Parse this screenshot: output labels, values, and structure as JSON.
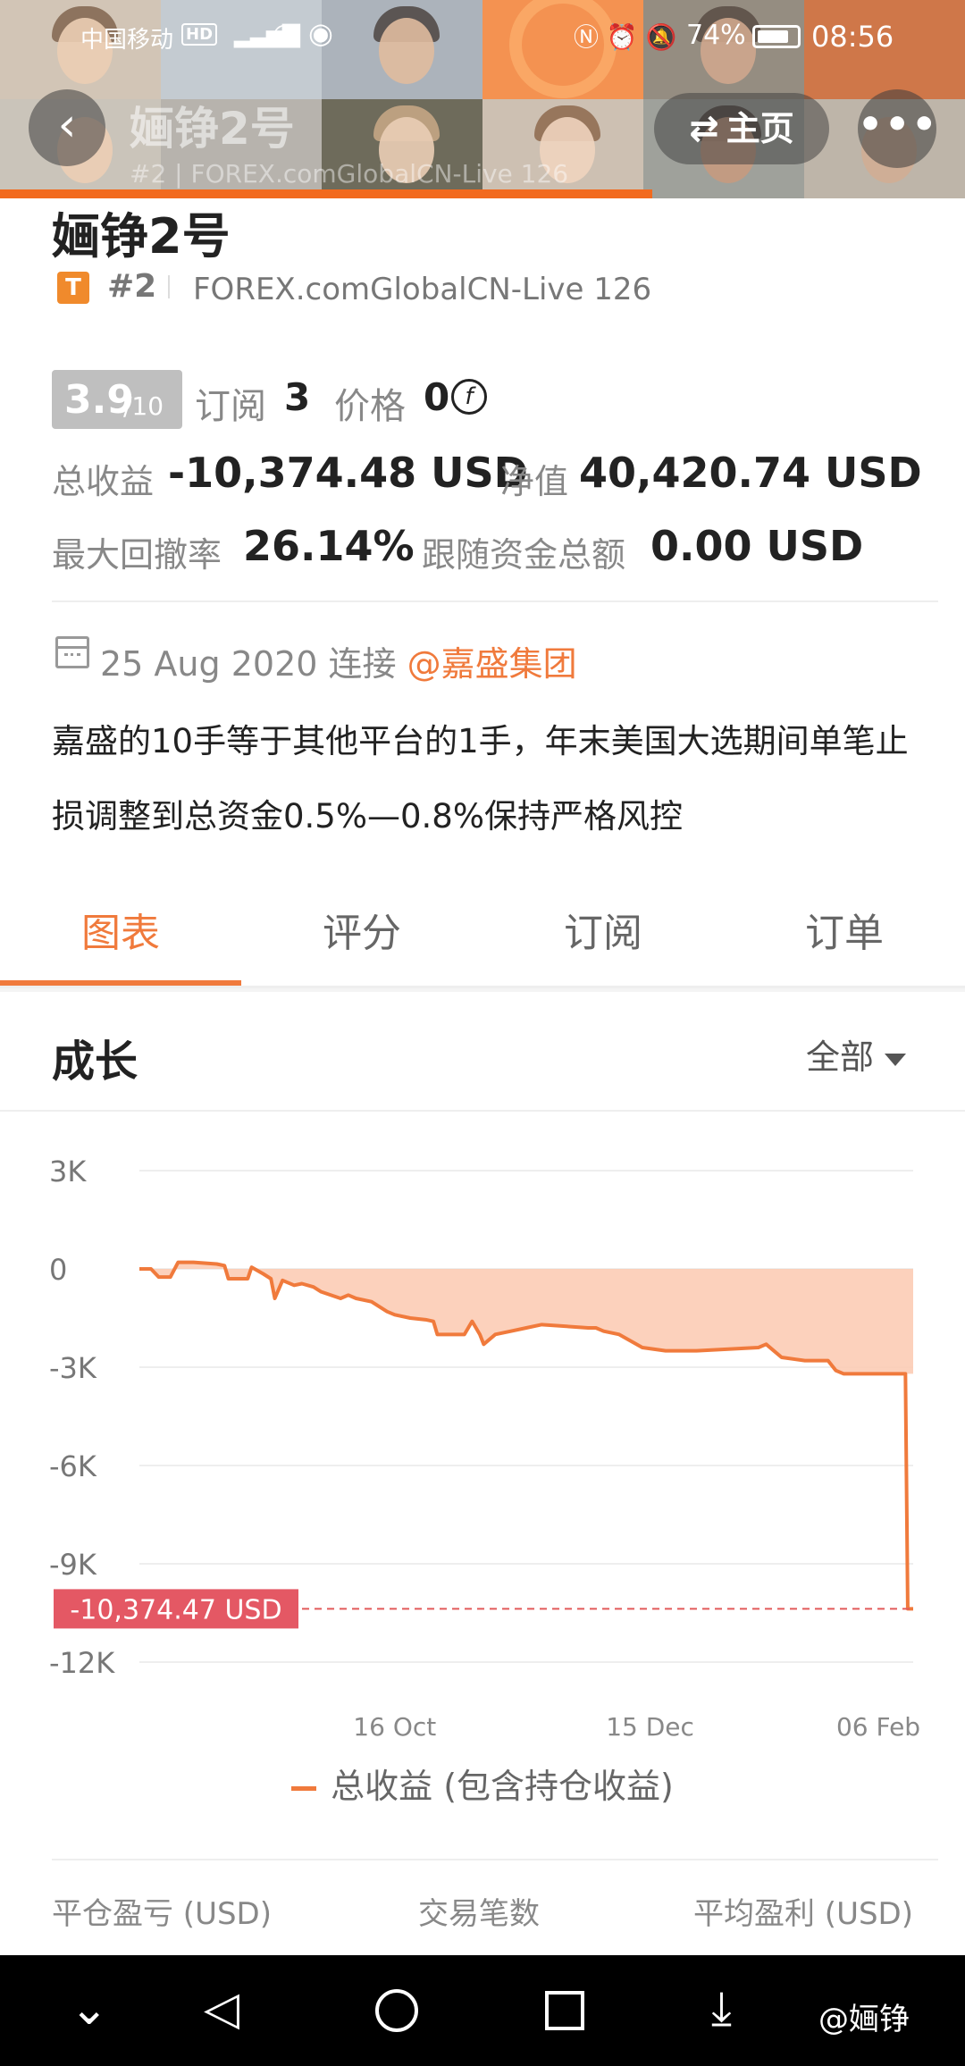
{
  "status_bar": {
    "carrier": "中国移动",
    "hd": "HD",
    "battery": "74%",
    "time": "08:56"
  },
  "nav": {
    "title": "婳铮2号",
    "subtitle": "#2 | FOREX.comGlobalCN-Live 126",
    "home_label": "主页"
  },
  "profile": {
    "name": "婳铮2号",
    "badge": "T",
    "rank": "#2",
    "server": "FOREX.comGlobalCN-Live 126",
    "score": "3.9",
    "score_max": "/10",
    "subscribe_label": "订阅",
    "subscribe_count": "3",
    "price_label": "价格",
    "price_value": "0",
    "total_profit_label": "总收益",
    "total_profit_value": "-10,374.48 USD",
    "equity_label": "净值",
    "equity_value": "40,420.74 USD",
    "max_drawdown_label": "最大回撤率",
    "max_drawdown_value": "26.14%",
    "follow_funds_label": "跟随资金总额",
    "follow_funds_value": "0.00 USD",
    "connected_date": "25 Aug 2020 连接",
    "connected_broker": "@嘉盛集团",
    "description": "嘉盛的10手等于其他平台的1手，年末美国大选期间单笔止损调整到总资金0.5%—0.8%保持严格风控"
  },
  "tabs": [
    {
      "label": "图表",
      "active": true
    },
    {
      "label": "评分",
      "active": false
    },
    {
      "label": "订阅",
      "active": false
    },
    {
      "label": "订单",
      "active": false
    }
  ],
  "growth": {
    "title": "成长",
    "range": "全部"
  },
  "chart_data": {
    "type": "area",
    "title": "",
    "xlabel": "",
    "ylabel": "",
    "ylim": [
      -12000,
      3000
    ],
    "yticks": [
      "3K",
      "0",
      "-3K",
      "-6K",
      "-9K",
      "-12K"
    ],
    "xticks": [
      "16 Oct",
      "15 Dec",
      "06 Feb"
    ],
    "grid": true,
    "color": "#f07a3c",
    "fill_color": "#fcc9b0",
    "current_value_label": "-10,374.47 USD",
    "current_value": -10374.47,
    "series": [
      {
        "name": "总收益 (包含持仓收益)",
        "x_normalized_time": [
          0.0,
          0.015,
          0.025,
          0.04,
          0.05,
          0.07,
          0.1,
          0.11,
          0.115,
          0.13,
          0.14,
          0.145,
          0.16,
          0.17,
          0.175,
          0.185,
          0.19,
          0.2,
          0.21,
          0.225,
          0.235,
          0.26,
          0.27,
          0.28,
          0.3,
          0.32,
          0.33,
          0.35,
          0.37,
          0.38,
          0.385,
          0.39,
          0.4,
          0.42,
          0.43,
          0.44,
          0.445,
          0.46,
          0.48,
          0.5,
          0.52,
          0.55,
          0.58,
          0.59,
          0.6,
          0.62,
          0.65,
          0.68,
          0.7,
          0.72,
          0.8,
          0.81,
          0.82,
          0.83,
          0.86,
          0.89,
          0.9,
          0.91,
          0.93,
          0.95,
          0.97,
          0.99,
          0.993,
          1.0
        ],
        "values": [
          0,
          0,
          -250,
          -250,
          200,
          200,
          150,
          100,
          -300,
          -300,
          -300,
          50,
          -150,
          -300,
          -900,
          -350,
          -400,
          -500,
          -450,
          -550,
          -700,
          -900,
          -800,
          -900,
          -1000,
          -1300,
          -1400,
          -1500,
          -1550,
          -1600,
          -2000,
          -2000,
          -2000,
          -2000,
          -1600,
          -2000,
          -2300,
          -2000,
          -1900,
          -1800,
          -1700,
          -1750,
          -1800,
          -1800,
          -1900,
          -2000,
          -2400,
          -2500,
          -2500,
          -2500,
          -2400,
          -2300,
          -2500,
          -2700,
          -2800,
          -2800,
          -3100,
          -3200,
          -3200,
          -3200,
          -3200,
          -3200,
          -10374.47,
          -10374.47
        ]
      }
    ],
    "legend": "总收益 (包含持仓收益)"
  },
  "footer_stats": {
    "closed_pnl": "平仓盈亏 (USD)",
    "trade_count": "交易笔数",
    "avg_profit": "平均盈利 (USD)"
  },
  "system_nav": {
    "watermark": "@婳铮"
  }
}
